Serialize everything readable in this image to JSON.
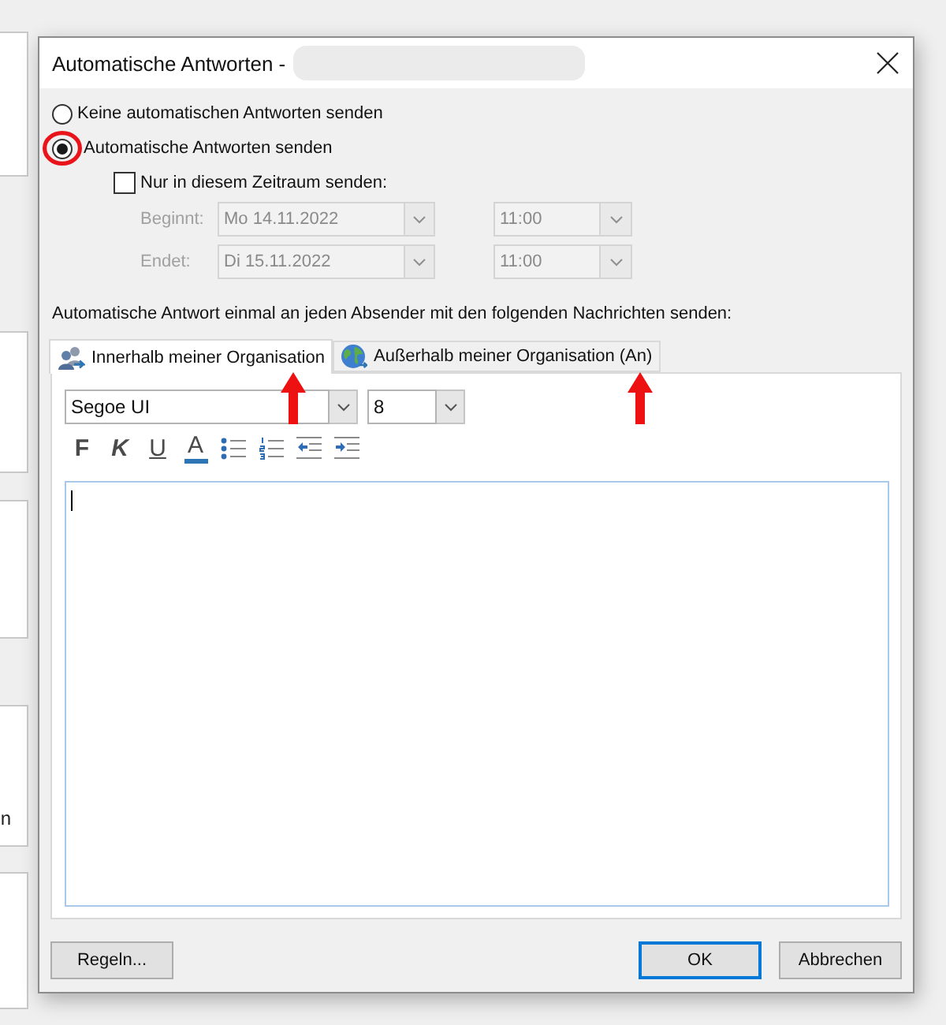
{
  "background": {
    "cut_text": "n"
  },
  "window": {
    "title": "Automatische Antworten -",
    "name_redacted": true
  },
  "reply_mode": [
    {
      "label": "Keine automatischen Antworten senden",
      "selected": false,
      "circled": false
    },
    {
      "label": "Automatische Antworten senden",
      "selected": true,
      "circled": true
    }
  ],
  "time_range": {
    "label": "Nur in diesem Zeitraum senden:",
    "checked": false,
    "rows": [
      {
        "label": "Beginnt:",
        "date": "Mo 14.11.2022",
        "time": "11:00",
        "disabled": true
      },
      {
        "label": "Endet:",
        "date": "Di 15.11.2022",
        "time": "11:00",
        "disabled": true
      }
    ]
  },
  "instruction": "Automatische Antwort einmal an jeden Absender mit den folgenden Nachrichten senden:",
  "tabs": [
    {
      "label": "Innerhalb meiner Organisation",
      "kind": "internal",
      "selected": true,
      "arrow_marker": true
    },
    {
      "label": "Außerhalb meiner Organisation (An)",
      "kind": "external",
      "selected": false,
      "arrow_marker": true
    }
  ],
  "editor": {
    "font": "Segoe UI",
    "size": "8",
    "toolbar": [
      {
        "kind": "bold",
        "label": "F"
      },
      {
        "kind": "italic",
        "label": "K"
      },
      {
        "kind": "underline",
        "label": "U"
      },
      {
        "kind": "font_color",
        "label": "A"
      },
      {
        "kind": "bullets"
      },
      {
        "kind": "numbering"
      },
      {
        "kind": "outdent"
      },
      {
        "kind": "indent"
      }
    ],
    "focused": true
  },
  "buttons": [
    {
      "label": "Regeln...",
      "default": false
    },
    {
      "label": "OK",
      "default": true
    },
    {
      "label": "Abbrechen",
      "default": false
    }
  ]
}
